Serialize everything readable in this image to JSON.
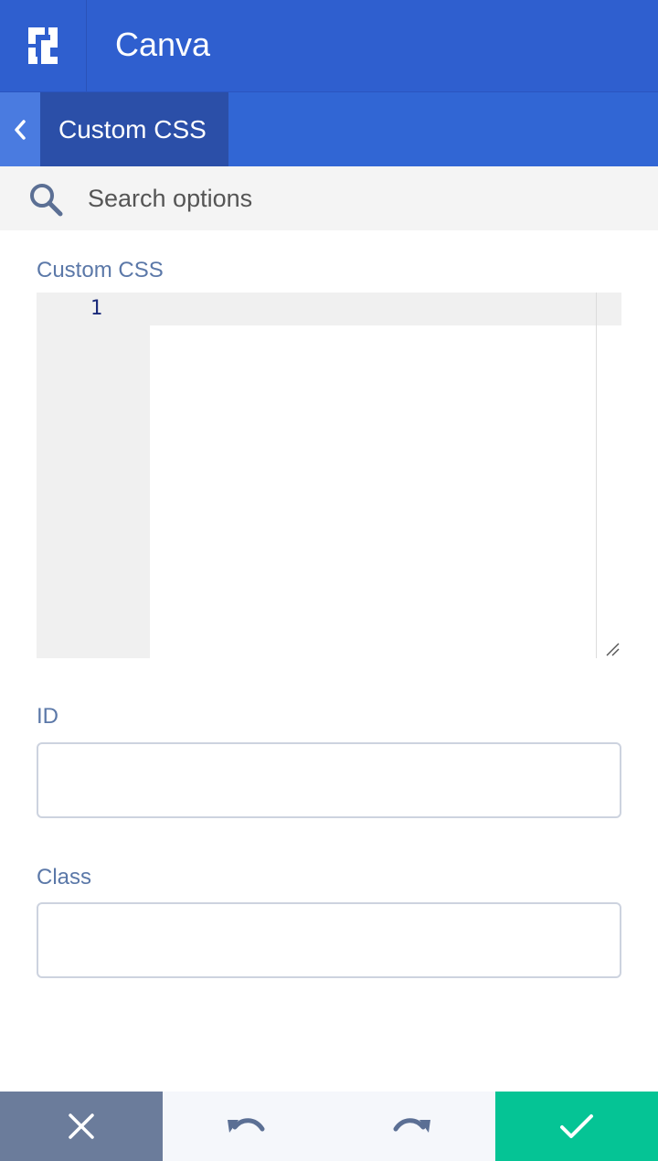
{
  "header": {
    "app_title": "Canva",
    "logo_icon": "canva-logo-icon",
    "background_color": "#2f5fcf"
  },
  "subheader": {
    "back_icon": "chevron-left-icon",
    "breadcrumb": "Custom CSS"
  },
  "search": {
    "placeholder": "Search options",
    "value": "",
    "icon": "search-icon"
  },
  "custom_css": {
    "label": "Custom CSS",
    "line_numbers": [
      "1"
    ],
    "content": ""
  },
  "id_field": {
    "label": "ID",
    "value": ""
  },
  "class_field": {
    "label": "Class",
    "value": ""
  },
  "footer": {
    "close_icon": "close-icon",
    "undo_icon": "undo-icon",
    "redo_icon": "redo-icon",
    "save_icon": "checkmark-icon",
    "close_color": "#6b7c9b",
    "save_color": "#05c495"
  }
}
